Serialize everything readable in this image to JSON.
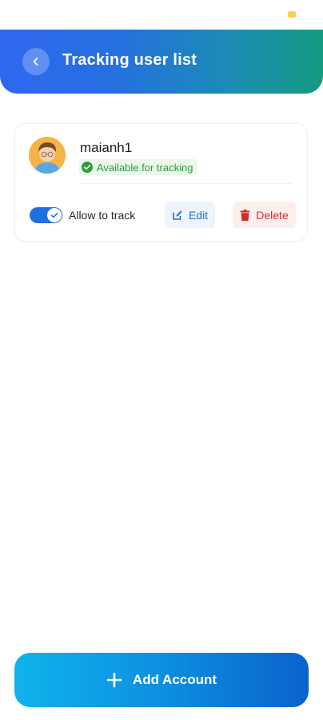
{
  "header": {
    "title": "Tracking user list",
    "gradient_start": "#2f67f0",
    "gradient_end": "#159a82"
  },
  "icons": {
    "back": "chevron-left-icon",
    "status": "check-circle-icon",
    "toggle": "check-icon",
    "edit": "edit-icon",
    "delete": "trash-icon",
    "add": "plus-icon"
  },
  "users": [
    {
      "name": "maianh1",
      "status": "Available for tracking",
      "allow_label": "Allow to track",
      "allow_enabled": true,
      "edit_label": "Edit",
      "delete_label": "Delete"
    }
  ],
  "footer": {
    "add_label": "Add Account"
  },
  "colors": {
    "primary": "#1f6fe0",
    "success": "#2f9a3f",
    "danger": "#d32a2a"
  }
}
